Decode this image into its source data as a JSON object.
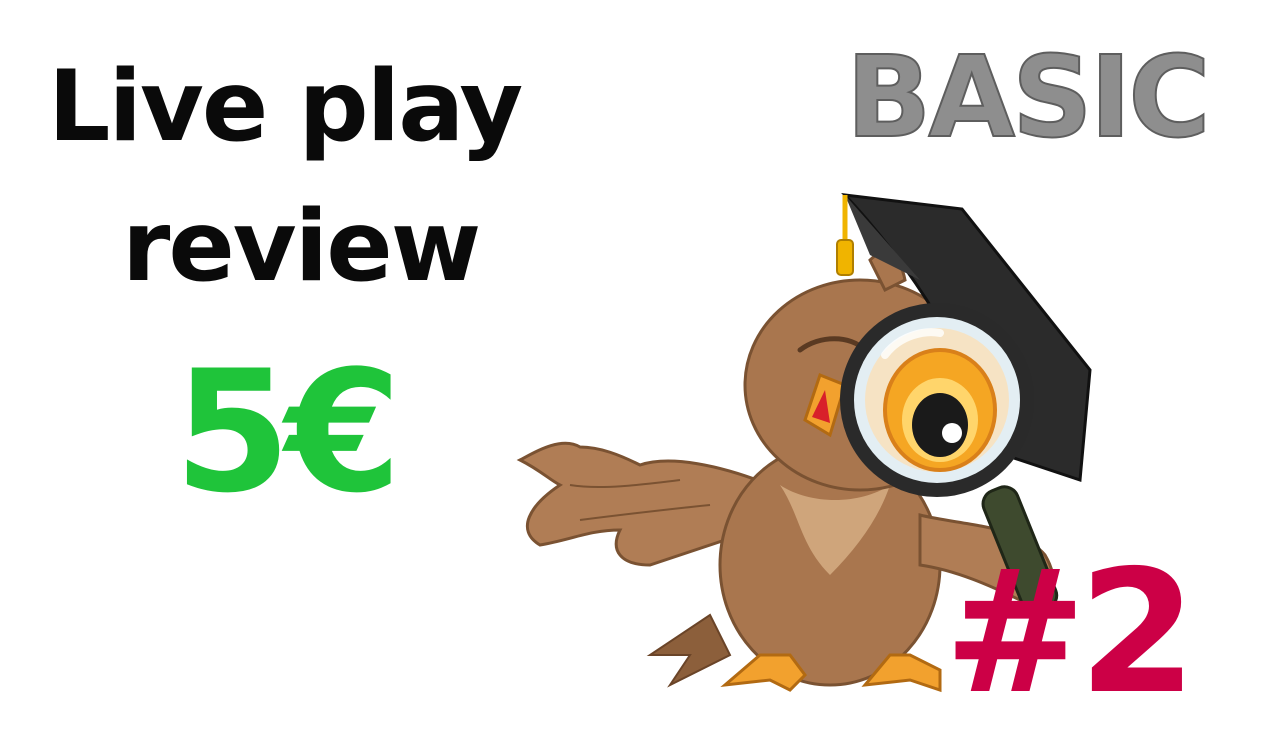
{
  "title": {
    "line1": "Live play",
    "line2": "review"
  },
  "price": "5€",
  "tier": "BASIC",
  "episode": "#2",
  "illustration": {
    "subject": "owl",
    "accessories": [
      "graduation-cap",
      "magnifying-glass"
    ]
  },
  "colors": {
    "title": "#0a0a0a",
    "price": "#1fc43a",
    "tier": "#8e8e8e",
    "episode": "#cc0046",
    "owl_body": "#a9764e",
    "owl_feet": "#f2a12e",
    "cap": "#2b2b2b",
    "tassel": "#f0b400"
  }
}
